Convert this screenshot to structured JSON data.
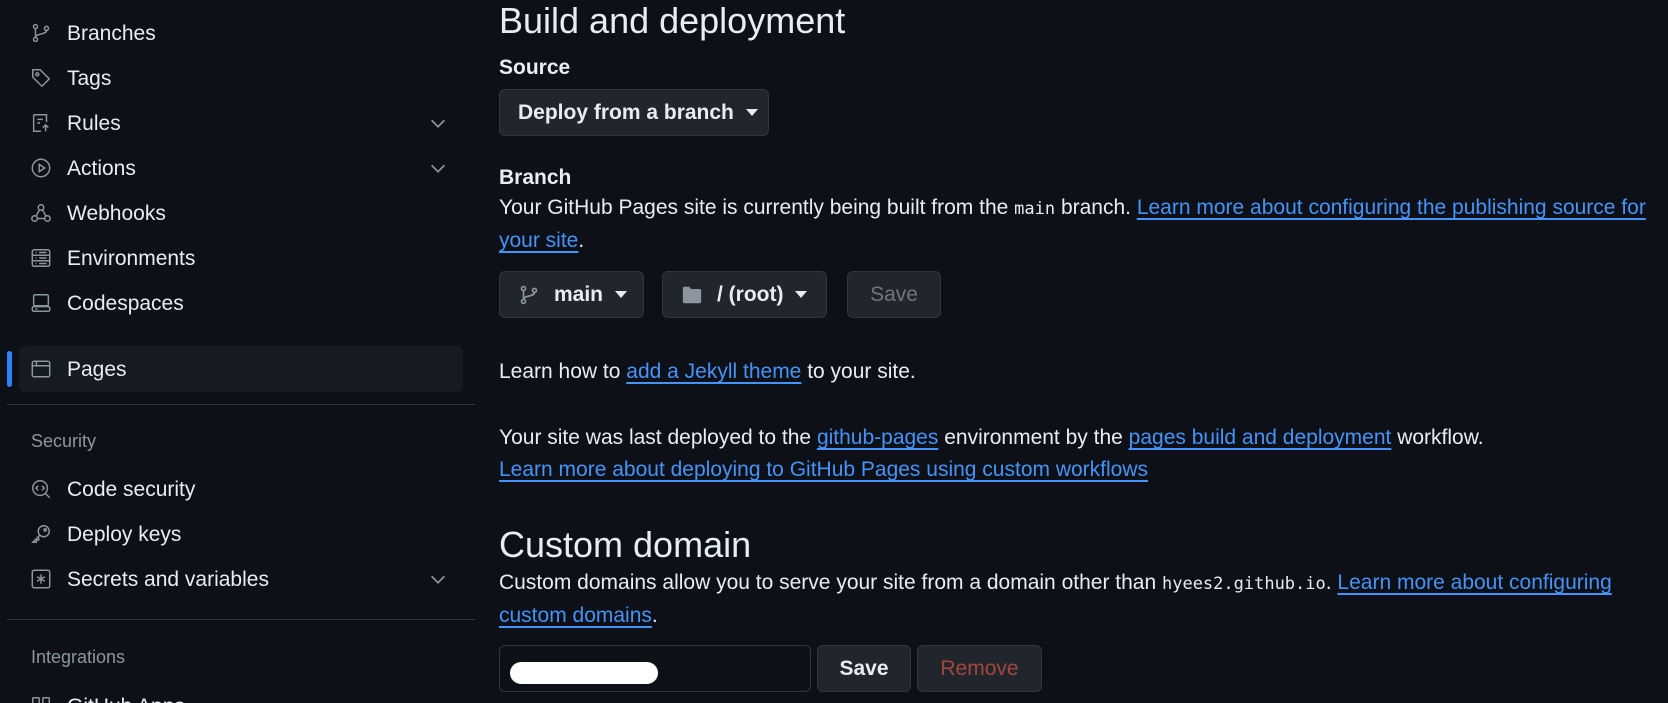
{
  "sidebar": {
    "items": [
      {
        "label": "Branches",
        "icon": "git-branch-icon"
      },
      {
        "label": "Tags",
        "icon": "tag-icon"
      },
      {
        "label": "Rules",
        "icon": "rules-icon",
        "expandable": true
      },
      {
        "label": "Actions",
        "icon": "play-icon",
        "expandable": true
      },
      {
        "label": "Webhooks",
        "icon": "webhook-icon"
      },
      {
        "label": "Environments",
        "icon": "server-icon"
      },
      {
        "label": "Codespaces",
        "icon": "codespaces-icon"
      },
      {
        "label": "Pages",
        "icon": "browser-icon",
        "selected": true
      }
    ],
    "security_title": "Security",
    "security_items": [
      {
        "label": "Code security",
        "icon": "codescan-icon"
      },
      {
        "label": "Deploy keys",
        "icon": "key-icon"
      },
      {
        "label": "Secrets and variables",
        "icon": "asterisk-icon",
        "expandable": true
      }
    ],
    "integrations_title": "Integrations",
    "integrations_items": [
      {
        "label": "GitHub Apps",
        "icon": "apps-icon"
      }
    ]
  },
  "build": {
    "title": "Build and deployment",
    "source_label": "Source",
    "source_value": "Deploy from a branch",
    "branch_label": "Branch",
    "branch_text_1": "Your GitHub Pages site is currently being built from the ",
    "branch_code": "main",
    "branch_text_2": " branch. ",
    "branch_link": "Learn more about configuring the publishing source for your site",
    "branch_text_3": ".",
    "branch_select": "main",
    "folder_select": "/ (root)",
    "save_label": "Save",
    "jekyll_text_1": "Learn how to ",
    "jekyll_link": "add a Jekyll theme",
    "jekyll_text_2": " to your site.",
    "deployed_text_1": "Your site was last deployed to the ",
    "deployed_link_env": "github-pages",
    "deployed_text_2": " environment by the ",
    "deployed_link_workflow": "pages build and deployment",
    "deployed_text_3": " workflow.",
    "deployed_link_custom": "Learn more about deploying to GitHub Pages using custom workflows"
  },
  "custom_domain": {
    "title": "Custom domain",
    "text_1": "Custom domains allow you to serve your site from a domain other than ",
    "domain_code": "hyees2.github.io",
    "text_2": ". ",
    "link": "Learn more about configuring custom domains",
    "text_3": ".",
    "save_label": "Save",
    "remove_label": "Remove"
  },
  "colors": {
    "background": "#0d1117",
    "link": "#4493f8",
    "accent": "#2f81f7",
    "danger_disabled": "#a5453d"
  }
}
